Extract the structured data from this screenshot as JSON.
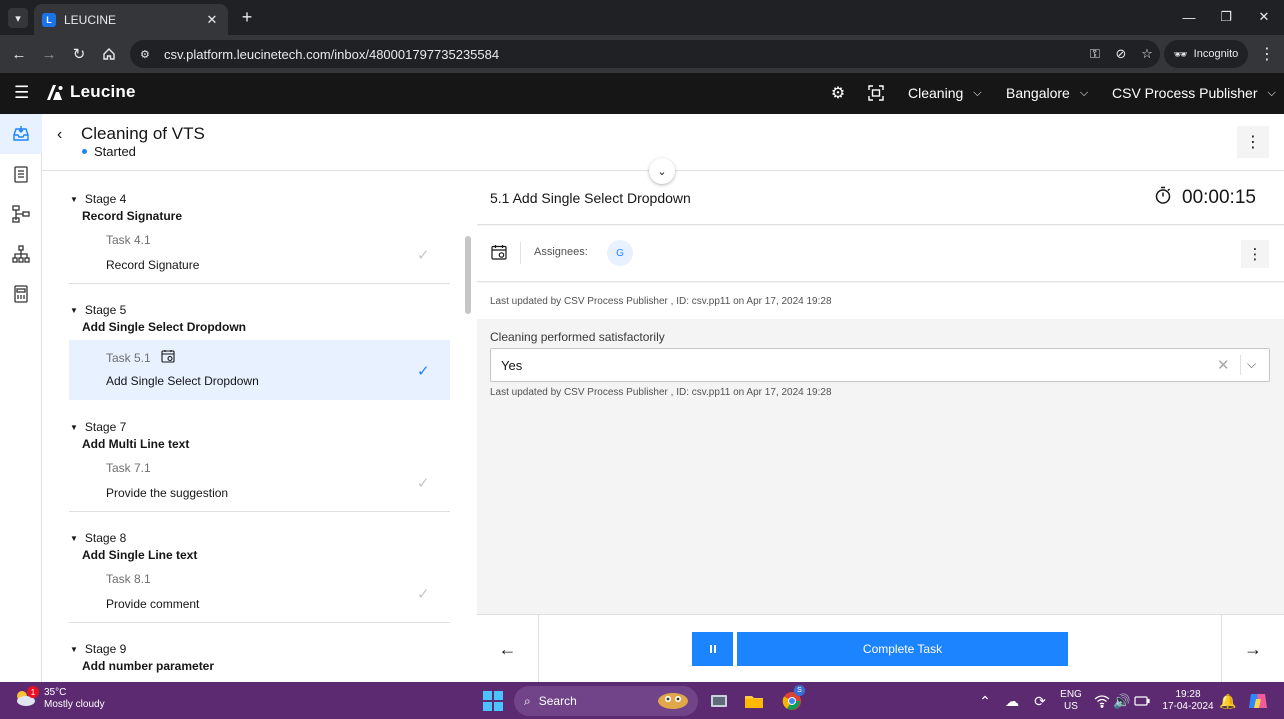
{
  "browser": {
    "tab_title": "LEUCINE",
    "url": "csv.platform.leucinetech.com/inbox/480001797735235584",
    "incognito_label": "Incognito"
  },
  "app": {
    "brand": "Leucine",
    "facility_select": "Cleaning",
    "site_select": "Bangalore",
    "role_select": "CSV Process Publisher"
  },
  "page": {
    "title": "Cleaning of VTS",
    "status": "Started"
  },
  "stages": [
    {
      "number": "Stage 4",
      "name": "Record Signature",
      "task_number": "Task 4.1",
      "task_name": "Record Signature"
    },
    {
      "number": "Stage 5",
      "name": "Add Single Select Dropdown",
      "task_number": "Task 5.1",
      "task_name": "Add Single Select Dropdown"
    },
    {
      "number": "Stage 7",
      "name": "Add Multi Line text",
      "task_number": "Task 7.1",
      "task_name": "Provide the suggestion"
    },
    {
      "number": "Stage 8",
      "name": "Add Single Line text",
      "task_number": "Task 8.1",
      "task_name": "Provide comment"
    },
    {
      "number": "Stage 9",
      "name": "Add number parameter"
    }
  ],
  "task_detail": {
    "title": "5.1 Add Single Select Dropdown",
    "timer": "00:00:15",
    "assignees_label": "Assignees:",
    "assignee_initial": "G",
    "last_updated": "Last updated by CSV Process Publisher , ID: csv.pp11 on Apr 17, 2024 19:28",
    "parameter_label": "Cleaning performed satisfactorily",
    "parameter_value": "Yes",
    "parameter_last_updated": "Last updated by CSV Process Publisher , ID: csv.pp11 on Apr 17, 2024 19:28",
    "complete_button": "Complete Task"
  },
  "taskbar": {
    "weather_badge": "1",
    "temperature": "35°C",
    "weather": "Mostly cloudy",
    "search_placeholder": "Search",
    "chrome_badge": "S",
    "lang_top": "ENG",
    "lang_bottom": "US",
    "time": "19:28",
    "date": "17-04-2024"
  },
  "colors": {
    "accent": "#1d84ff",
    "header_bg": "#161616",
    "selected_row": "#e7f1ff",
    "taskbar_bg": "#5b2a70"
  }
}
